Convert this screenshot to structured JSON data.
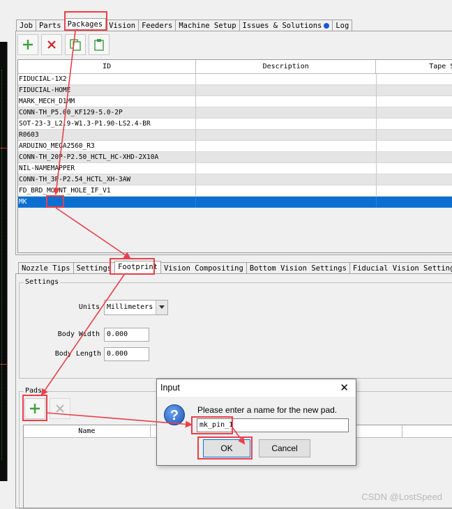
{
  "top_tabs": [
    "Job",
    "Parts",
    "Packages",
    "Vision",
    "Feeders",
    "Machine Setup",
    "Issues & Solutions",
    "Log"
  ],
  "toolbar": {
    "new_icon": "plus-icon",
    "delete_icon": "delete-x-icon",
    "copy_icon": "copy-icon",
    "paste_icon": "paste-icon"
  },
  "packages_table": {
    "columns": [
      "ID",
      "Description",
      "Tape S"
    ],
    "rows": [
      "FIDUCIAL-1X2",
      "FIDUCIAL-HOME",
      "MARK_MECH_D1MM",
      "CONN-TH_P5.00_KF129-5.0-2P",
      "SOT-23-3_L2.9-W1.3-P1.90-LS2.4-BR",
      "R0603",
      "ARDUINO_MEGA2560_R3",
      "CONN-TH_20P-P2.50_HCTL_HC-XHD-2X10A",
      "NIL-NAMEMAPPER",
      "CONN-TH_3P-P2.54_HCTL_XH-3AW",
      "FD_BRD_MOUNT_HOLE_IF_V1",
      "MK"
    ],
    "selected_index": 11
  },
  "bottom_tabs": [
    "Nozzle Tips",
    "Settings",
    "Footprint",
    "Vision Compositing",
    "Bottom Vision Settings",
    "Fiducial Vision Settings"
  ],
  "settings": {
    "legend": "Settings",
    "units_label": "Units",
    "units_value": "Millimeters",
    "body_width_label": "Body Width",
    "body_width_value": "0.000",
    "body_length_label": "Body Length",
    "body_length_value": "0.000"
  },
  "pads": {
    "legend": "Pads",
    "columns": [
      "Name"
    ]
  },
  "dialog": {
    "title": "Input",
    "close": "✕",
    "message": "Please enter a name for the new pad.",
    "input_value": "mk_pin_1",
    "ok_label": "OK",
    "cancel_label": "Cancel"
  },
  "colors": {
    "selection": "#0a6fd1",
    "annotation": "#e8404a",
    "add_icon": "#3ca23c",
    "delete_icon": "#d42020"
  },
  "watermark": "CSDN @LostSpeed"
}
